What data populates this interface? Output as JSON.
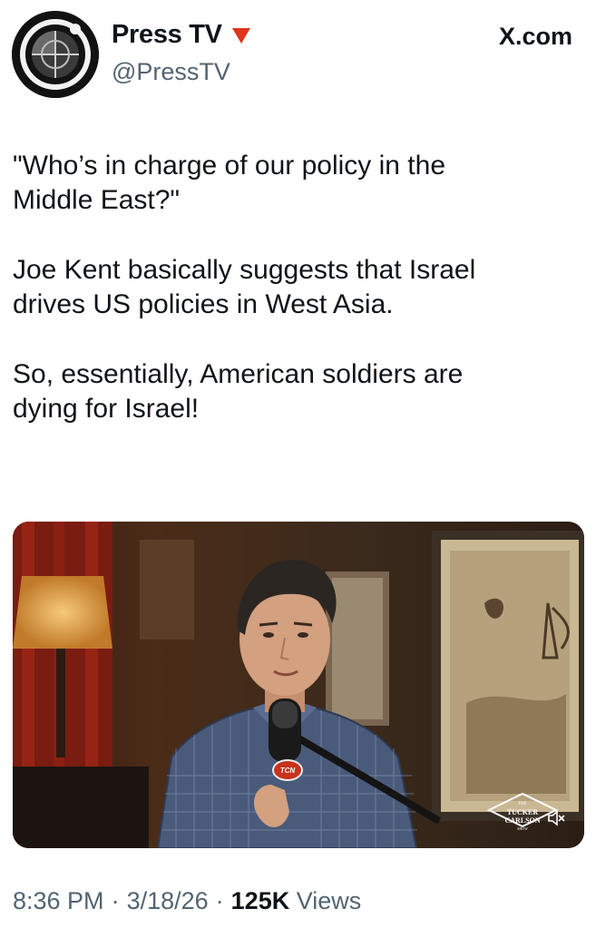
{
  "header": {
    "display_name": "Press TV",
    "handle": "@PressTV",
    "source": "X.com"
  },
  "tweet": {
    "paragraphs": [
      "\"Who’s in charge of our policy in the\nMiddle East?\"",
      "Joe Kent basically suggests that Israel\ndrives US policies in West Asia.",
      "So, essentially, American soldiers are\ndying for Israel!"
    ]
  },
  "media": {
    "mic_label": "TCN",
    "watermark": {
      "line1": "THE",
      "line2": "TUCKER",
      "line3": "CARLSON",
      "line4": "SHOW"
    },
    "mute_icon": "speaker-muted-icon"
  },
  "footer": {
    "time": "8:36 PM",
    "date": "3/18/26",
    "views_count": "125K",
    "views_label": "Views"
  },
  "colors": {
    "text_primary": "#0f1419",
    "text_secondary": "#536471",
    "badge_red": "#e0341e"
  }
}
